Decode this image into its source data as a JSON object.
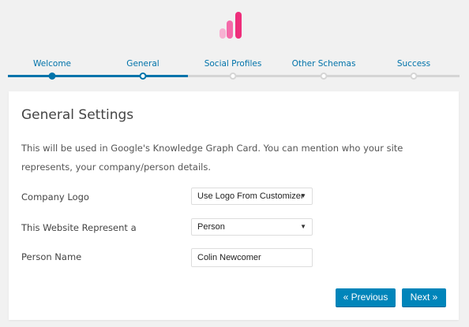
{
  "logo": {
    "icon": "bar-chart-logo-icon",
    "colors": [
      "#f7b0d2",
      "#f46aa9",
      "#ee2e7b"
    ]
  },
  "colors": {
    "accent": "#0073aa",
    "button": "#0085ba",
    "track_inactive": "#d5d5d5"
  },
  "steps": [
    {
      "label": "Welcome",
      "state": "done"
    },
    {
      "label": "General",
      "state": "current"
    },
    {
      "label": "Social Profiles",
      "state": "todo"
    },
    {
      "label": "Other Schemas",
      "state": "todo"
    },
    {
      "label": "Success",
      "state": "todo"
    }
  ],
  "card": {
    "title": "General Settings",
    "description": "This will be used in Google's Knowledge Graph Card. You can mention who your site represents, your company/person details."
  },
  "fields": {
    "company_logo": {
      "label": "Company Logo",
      "value": "Use Logo From Customizer"
    },
    "represent": {
      "label": "This Website Represent a",
      "value": "Person"
    },
    "person_name": {
      "label": "Person Name",
      "value": "Colin Newcomer"
    }
  },
  "buttons": {
    "previous": "« Previous",
    "next": "Next »"
  }
}
